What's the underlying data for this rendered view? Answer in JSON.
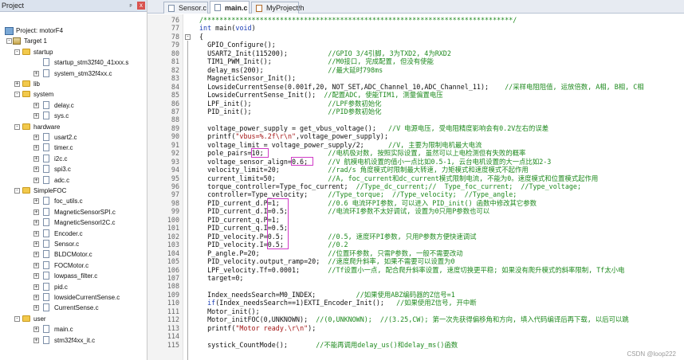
{
  "panel": {
    "title": "Project",
    "pin": "ᵖ",
    "close": "x"
  },
  "tree": [
    {
      "label": "Project: motorF4",
      "depth": 0,
      "kind": "project",
      "exp": ""
    },
    {
      "label": "Target 1",
      "depth": 1,
      "kind": "target",
      "exp": "−"
    },
    {
      "label": "startup",
      "depth": 2,
      "kind": "folder",
      "exp": "−"
    },
    {
      "label": "startup_stm32f40_41xxx.s",
      "depth": 3,
      "kind": "file",
      "exp": ""
    },
    {
      "label": "system_stm32f4xx.c",
      "depth": 3,
      "kind": "file",
      "exp": "+"
    },
    {
      "label": "lib",
      "depth": 2,
      "kind": "folder",
      "exp": "+"
    },
    {
      "label": "system",
      "depth": 2,
      "kind": "folder",
      "exp": "−"
    },
    {
      "label": "delay.c",
      "depth": 3,
      "kind": "file",
      "exp": "+"
    },
    {
      "label": "sys.c",
      "depth": 3,
      "kind": "file",
      "exp": "+"
    },
    {
      "label": "hardware",
      "depth": 2,
      "kind": "folder",
      "exp": "−"
    },
    {
      "label": "usart2.c",
      "depth": 3,
      "kind": "file",
      "exp": "+"
    },
    {
      "label": "timer.c",
      "depth": 3,
      "kind": "file",
      "exp": "+"
    },
    {
      "label": "i2c.c",
      "depth": 3,
      "kind": "file",
      "exp": "+"
    },
    {
      "label": "spi3.c",
      "depth": 3,
      "kind": "file",
      "exp": "+"
    },
    {
      "label": "adc.c",
      "depth": 3,
      "kind": "file",
      "exp": "+"
    },
    {
      "label": "SimpleFOC",
      "depth": 2,
      "kind": "folder",
      "exp": "−"
    },
    {
      "label": "foc_utils.c",
      "depth": 3,
      "kind": "file",
      "exp": "+"
    },
    {
      "label": "MagneticSensorSPI.c",
      "depth": 3,
      "kind": "file",
      "exp": "+"
    },
    {
      "label": "MagneticSensorI2C.c",
      "depth": 3,
      "kind": "file",
      "exp": "+"
    },
    {
      "label": "Encoder.c",
      "depth": 3,
      "kind": "file",
      "exp": "+"
    },
    {
      "label": "Sensor.c",
      "depth": 3,
      "kind": "file",
      "exp": "+"
    },
    {
      "label": "BLDCMotor.c",
      "depth": 3,
      "kind": "file",
      "exp": "+"
    },
    {
      "label": "FOCMotor.c",
      "depth": 3,
      "kind": "file",
      "exp": "+"
    },
    {
      "label": "lowpass_filter.c",
      "depth": 3,
      "kind": "file",
      "exp": "+"
    },
    {
      "label": "pid.c",
      "depth": 3,
      "kind": "file",
      "exp": "+"
    },
    {
      "label": "lowsideCurrentSense.c",
      "depth": 3,
      "kind": "file",
      "exp": "+"
    },
    {
      "label": "CurrentSense.c",
      "depth": 3,
      "kind": "file",
      "exp": "+"
    },
    {
      "label": "user",
      "depth": 2,
      "kind": "folder",
      "exp": "−"
    },
    {
      "label": "main.c",
      "depth": 3,
      "kind": "file",
      "exp": "+"
    },
    {
      "label": "stm32f4xx_it.c",
      "depth": 3,
      "kind": "file",
      "exp": "+"
    }
  ],
  "tabs": [
    {
      "label": "Sensor.c",
      "active": false,
      "icon": "c-file-icon"
    },
    {
      "label": "main.c",
      "active": true,
      "icon": "c-file-icon"
    },
    {
      "label": "MyProject.h",
      "active": false,
      "icon": "h-file-icon"
    }
  ],
  "code_lines": [
    {
      "n": "76",
      "t": [
        [
          "cm",
          "/*****************************************************************************/"
        ]
      ]
    },
    {
      "n": "77",
      "t": [
        [
          "kw",
          "int"
        ],
        [
          "",
          " main("
        ],
        [
          "kw",
          "void"
        ],
        [
          "",
          ")"
        ]
      ]
    },
    {
      "n": "78",
      "t": [
        [
          "",
          "{"
        ]
      ],
      "fold": "−"
    },
    {
      "n": "79",
      "t": [
        [
          "",
          "  GPIO_Configure();"
        ]
      ]
    },
    {
      "n": "80",
      "t": [
        [
          "",
          "  USART2_Init(115200);          "
        ],
        [
          "cm",
          "//GPIO 3/4引脚, 3为TXD2, 4为RXD2"
        ]
      ]
    },
    {
      "n": "81",
      "t": [
        [
          "",
          "  TIM1_PWM_Init();              "
        ],
        [
          "cm",
          "//M0接口, 完成配置, 但没有使能"
        ]
      ]
    },
    {
      "n": "82",
      "t": [
        [
          "",
          "  delay_ms(200);                "
        ],
        [
          "cm",
          "//最大延时798ms"
        ]
      ]
    },
    {
      "n": "83",
      "t": [
        [
          "",
          "  MagneticSensor_Init();"
        ]
      ]
    },
    {
      "n": "84",
      "t": [
        [
          "",
          "  LowsideCurrentSense(0.001f,20, NOT_SET,ADC_Channel_10,ADC_Channel_11);    "
        ],
        [
          "cm",
          "//采样电阻阻值, 运放倍数, A相, B相, C相"
        ]
      ]
    },
    {
      "n": "85",
      "t": [
        [
          "",
          "  LowsideCurrentSense_Init();  "
        ],
        [
          "cm",
          "//配置ADC, 使能TIM1, 测量偏置电压"
        ]
      ]
    },
    {
      "n": "86",
      "t": [
        [
          "",
          "  LPF_init();                   "
        ],
        [
          "cm",
          "//LPF参数初始化"
        ]
      ]
    },
    {
      "n": "87",
      "t": [
        [
          "",
          "  PID_init();                   "
        ],
        [
          "cm",
          "//PID参数初始化"
        ]
      ]
    },
    {
      "n": "88",
      "t": [
        [
          "",
          ""
        ]
      ]
    },
    {
      "n": "89",
      "t": [
        [
          "",
          "  voltage_power_supply = get_vbus_voltage();   "
        ],
        [
          "cm",
          "//V 电源电压, 受电阻精度影响会有0.2V左右的误差"
        ]
      ]
    },
    {
      "n": "90",
      "t": [
        [
          "",
          "  printf("
        ],
        [
          "st",
          "\"vbus=%.2f\\r\\n\""
        ],
        [
          "",
          ",voltage_power_supply);"
        ]
      ]
    },
    {
      "n": "91",
      "t": [
        [
          "",
          "  voltage_limit = voltage_power_supply/2;      "
        ],
        [
          "cm",
          "//V, 主要为限制电机最大电流"
        ]
      ]
    },
    {
      "n": "92",
      "t": [
        [
          "",
          "  pole_pairs=10;                "
        ],
        [
          "cm",
          "//电机极对数, 按照实际设置, 虽然可以上电检测但有失败的概率"
        ]
      ]
    },
    {
      "n": "93",
      "t": [
        [
          "",
          "  voltage_sensor_align=0.6;     "
        ],
        [
          "cm",
          "//V 航模电机设置的值小一点比如0.5-1, 云台电机设置的大一点比如2-3"
        ]
      ]
    },
    {
      "n": "94",
      "t": [
        [
          "",
          "  velocity_limit=20;            "
        ],
        [
          "cm",
          "//rad/s 角度模式时限制最大转速, 力矩模式和速度模式不起作用"
        ]
      ]
    },
    {
      "n": "95",
      "t": [
        [
          "",
          "  current_limit=50;             "
        ],
        [
          "cm",
          "//A, foc_current和dc_current模式限制电流, 不能为0。速度模式和位置模式起作用"
        ]
      ]
    },
    {
      "n": "96",
      "t": [
        [
          "",
          "  torque_controller=Type_foc_current;  "
        ],
        [
          "cm",
          "//Type_dc_current;//  Type_foc_current;  //Type_voltage;"
        ]
      ]
    },
    {
      "n": "97",
      "t": [
        [
          "",
          "  controller=Type_velocity;     "
        ],
        [
          "cm",
          "//Type_torque;  //Type_velocity;  //Type_angle;"
        ]
      ]
    },
    {
      "n": "98",
      "t": [
        [
          "",
          "  PID_current_d.P=1;            "
        ],
        [
          "cm",
          "//0.6 电流环PI参数, 可以进入 PID_init() 函数中修改其它参数"
        ]
      ]
    },
    {
      "n": "99",
      "t": [
        [
          "",
          "  PID_current_d.I=0.5;          "
        ],
        [
          "cm",
          "//电流环I参数不太好调试, 设置为0只用P参数也可以"
        ]
      ]
    },
    {
      "n": "100",
      "t": [
        [
          "",
          "  PID_current_q.P=1;"
        ]
      ]
    },
    {
      "n": "101",
      "t": [
        [
          "",
          "  PID_current_q.I=0.5;"
        ]
      ]
    },
    {
      "n": "102",
      "t": [
        [
          "",
          "  PID_velocity.P=0.5;           "
        ],
        [
          "cm",
          "//0.5, 速度环PI参数, 只用P参数方便快速调试"
        ]
      ]
    },
    {
      "n": "103",
      "t": [
        [
          "",
          "  PID_velocity.I=0.5;           "
        ],
        [
          "cm",
          "//0.2"
        ]
      ]
    },
    {
      "n": "104",
      "t": [
        [
          "",
          "  P_angle.P=20;                 "
        ],
        [
          "cm",
          "//位置环参数, 只需P参数, 一般不需要改动"
        ]
      ]
    },
    {
      "n": "105",
      "t": [
        [
          "",
          "  PID_velocity.output_ramp=20;  "
        ],
        [
          "cm",
          "//速度爬升斜率, 如果不需要可以设置为0"
        ]
      ]
    },
    {
      "n": "106",
      "t": [
        [
          "",
          "  LPF_velocity.Tf=0.0001;       "
        ],
        [
          "cm",
          "//Tf设置小一点, 配合爬升斜率设置, 速度切换更平稳; 如果没有爬升模式的斜率限制, Tf太小电"
        ]
      ]
    },
    {
      "n": "107",
      "t": [
        [
          "",
          "  target=0;"
        ]
      ]
    },
    {
      "n": "108",
      "t": [
        [
          "",
          ""
        ]
      ]
    },
    {
      "n": "109",
      "t": [
        [
          "",
          "  Index_needsSearch=M0_INDEX;          "
        ],
        [
          "cm",
          "//如果使用ABZ编码器的Z信号=1"
        ]
      ]
    },
    {
      "n": "110",
      "t": [
        [
          "",
          "  "
        ],
        [
          "kw",
          "if"
        ],
        [
          "",
          "(Index_needsSearch==1)EXTI_Encoder_Init();   "
        ],
        [
          "cm",
          "//如果使用Z信号, 开中断"
        ]
      ]
    },
    {
      "n": "111",
      "t": [
        [
          "",
          "  Motor_init();"
        ]
      ]
    },
    {
      "n": "112",
      "t": [
        [
          "",
          "  Motor_initFOC(0,UNKNOWN);  "
        ],
        [
          "cm",
          "//(0,UNKNOWN);  //(3.25,CW); 第一次先获得偏移角和方向, 填入代码编译后再下载, 以后可以跳"
        ]
      ]
    },
    {
      "n": "113",
      "t": [
        [
          "",
          "  printf("
        ],
        [
          "st",
          "\"Motor ready.\\r\\n\""
        ],
        [
          "",
          ");"
        ]
      ]
    },
    {
      "n": "114",
      "t": [
        [
          "",
          ""
        ]
      ]
    },
    {
      "n": "115",
      "t": [
        [
          "",
          "  systick_CountMode();       "
        ],
        [
          "cm",
          "//不能再调用delay_us()和delay_ms()函数"
        ]
      ]
    }
  ],
  "watermark": "CSDN @loop222",
  "colors": {
    "keyword": "#1d3fb5",
    "comment": "#1f8a1f",
    "string": "#a31515",
    "highlight_box": "#d03ac7"
  }
}
